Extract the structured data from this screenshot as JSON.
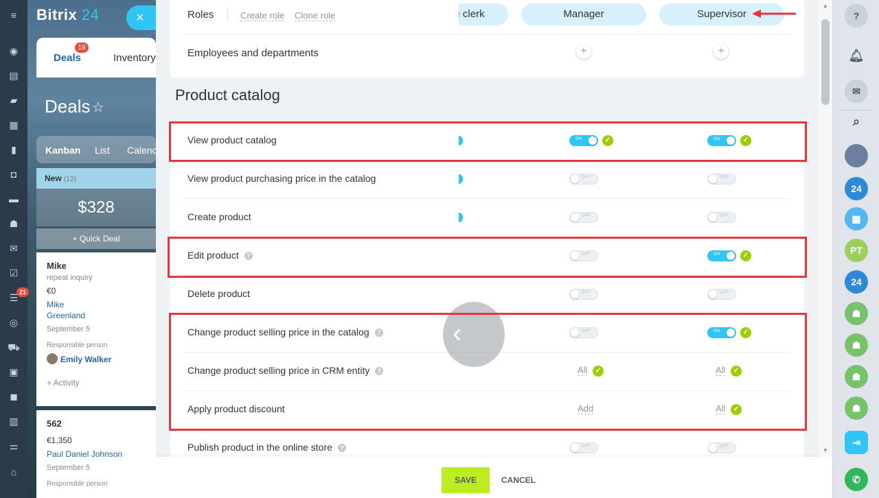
{
  "app": {
    "logo_text": "Bitrix",
    "logo_num": "24",
    "close_symbol": "×"
  },
  "left_sidebar": {
    "badge": "21"
  },
  "crm": {
    "tab_deals": "Deals",
    "tab_deals_badge": "19",
    "tab_inventory": "Inventory",
    "page_title": "Deals",
    "views": [
      "Kanban",
      "List",
      "Calend"
    ],
    "stage_name": "New",
    "stage_count": "(12)",
    "stage_sum": "$328",
    "quick_deal": "+ Quick Deal",
    "cards": [
      {
        "name": "Mike",
        "sub": "repeat inquiry",
        "amount": "€0",
        "links": [
          "Mike",
          "Greenland"
        ],
        "date": "September 5",
        "resp_label": "Responsible person",
        "resp_name": "Emily Walker",
        "activity": "+ Activity"
      },
      {
        "name": "562",
        "amount": "€1,350",
        "links": [
          "Paul Daniel Johnson"
        ],
        "date": "September 5",
        "resp_label": "Responsible person"
      }
    ]
  },
  "roles": {
    "label": "Roles",
    "create_role": "Create role",
    "clone_role": "Clone role",
    "pills": [
      "e clerk",
      "Manager",
      "Supervisor"
    ],
    "employees_label": "Employees and departments",
    "plus": "+"
  },
  "section": {
    "title": "Product catalog"
  },
  "permissions": [
    {
      "label": "View product catalog",
      "help": false,
      "manager": {
        "kind": "toggle",
        "on": true,
        "text": "ON"
      },
      "supervisor": {
        "kind": "toggle",
        "on": true,
        "text": "ON"
      }
    },
    {
      "label": "View product purchasing price in the catalog",
      "help": false,
      "manager": {
        "kind": "toggle",
        "on": false,
        "text": "OFF"
      },
      "supervisor": {
        "kind": "toggle",
        "on": false,
        "text": "OFF"
      }
    },
    {
      "label": "Create product",
      "help": false,
      "manager": {
        "kind": "toggle",
        "on": false,
        "text": "OFF"
      },
      "supervisor": {
        "kind": "toggle",
        "on": false,
        "text": "OFF"
      }
    },
    {
      "label": "Edit product",
      "help": true,
      "manager": {
        "kind": "toggle",
        "on": false,
        "text": "OFF"
      },
      "supervisor": {
        "kind": "toggle",
        "on": true,
        "text": "ON"
      }
    },
    {
      "label": "Delete product",
      "help": false,
      "manager": {
        "kind": "toggle",
        "on": false,
        "text": "OFF"
      },
      "supervisor": {
        "kind": "toggle",
        "on": false,
        "text": "OFF"
      }
    },
    {
      "label": "Change product selling price in the catalog",
      "help": true,
      "manager": {
        "kind": "toggle",
        "on": false,
        "text": "OFF"
      },
      "supervisor": {
        "kind": "toggle",
        "on": true,
        "text": "ON"
      }
    },
    {
      "label": "Change product selling price in CRM entity",
      "help": true,
      "manager": {
        "kind": "value",
        "text": "All",
        "check": true
      },
      "supervisor": {
        "kind": "value",
        "text": "All",
        "check": true
      }
    },
    {
      "label": "Apply product discount",
      "help": false,
      "manager": {
        "kind": "value",
        "text": "Add",
        "check": false
      },
      "supervisor": {
        "kind": "value",
        "text": "All",
        "check": true
      }
    },
    {
      "label": "Publish product in the online store",
      "help": true,
      "manager": {
        "kind": "toggle",
        "on": false,
        "text": "OFF"
      },
      "supervisor": {
        "kind": "toggle",
        "on": false,
        "text": "OFF"
      }
    }
  ],
  "footer": {
    "save": "SAVE",
    "cancel": "CANCEL"
  },
  "right_sidebar": {
    "help": "?",
    "avatar_initials": "PT",
    "bitrix_badge": "24"
  },
  "colors": {
    "accent": "#2fc6f6",
    "toggle_on": "#2fc6f6",
    "check": "#9dcf00",
    "save": "#bbed21",
    "highlight": "#e8343f"
  }
}
